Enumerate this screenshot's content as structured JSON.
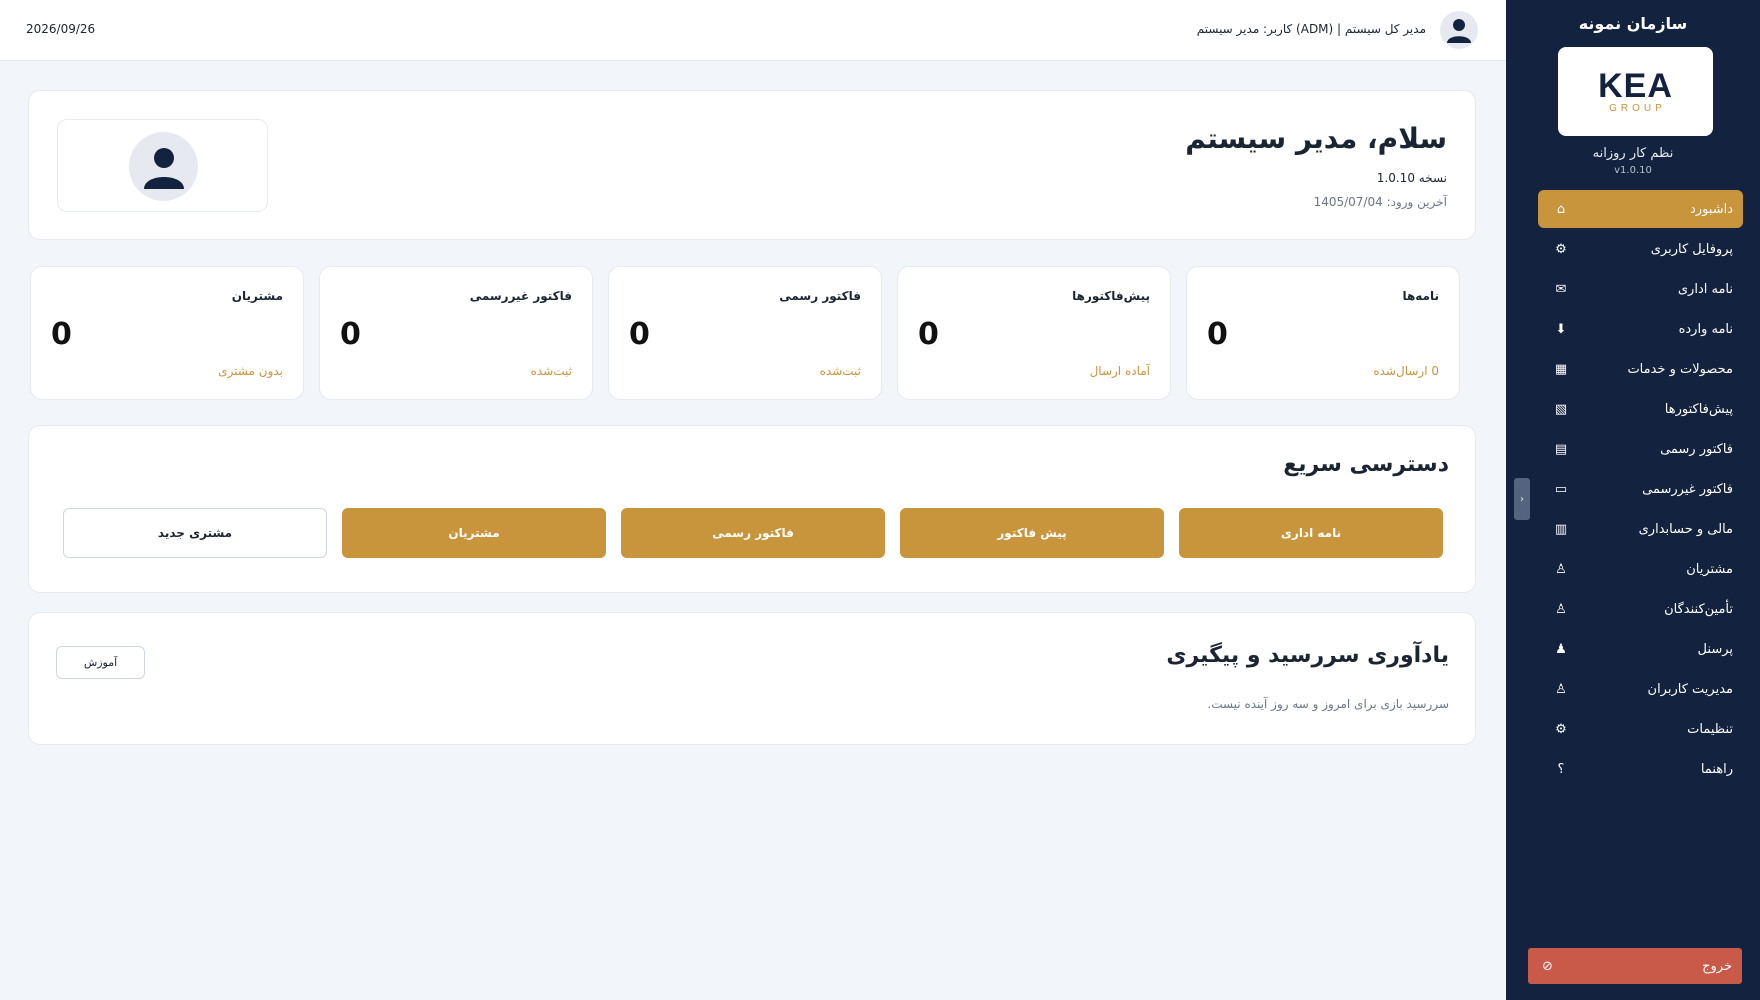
{
  "colors": {
    "sidebar_bg": "#13223f",
    "accent_gold": "#c8943c",
    "logout_red": "#c95a4a",
    "page_bg": "#f2f5f9"
  },
  "sidebar": {
    "org_name": "سازمان نمونه",
    "logo": {
      "main": "KEA",
      "sub": "GROUP"
    },
    "tagline": "نظم کار روزانه",
    "version": "v1.0.10",
    "items": [
      {
        "label": "داشبورد",
        "icon": "home-icon",
        "glyph": "⌂"
      },
      {
        "label": "پروفایل کاربری",
        "icon": "gear-icon",
        "glyph": "⚙"
      },
      {
        "label": "نامه اداری",
        "icon": "mail-icon",
        "glyph": "✉"
      },
      {
        "label": "نامه وارده",
        "icon": "download-icon",
        "glyph": "⬇"
      },
      {
        "label": "محصولات و خدمات",
        "icon": "grid-icon",
        "glyph": "▦"
      },
      {
        "label": "پیش‌فاکتورها",
        "icon": "hatched-doc-icon",
        "glyph": "▧"
      },
      {
        "label": "فاکتور رسمی",
        "icon": "lined-doc-icon",
        "glyph": "▤"
      },
      {
        "label": "فاکتور غیررسمی",
        "icon": "rectangle-icon",
        "glyph": "▭"
      },
      {
        "label": "مالی و حسابداری",
        "icon": "ledger-icon",
        "glyph": "▥"
      },
      {
        "label": "مشتریان",
        "icon": "person-icon",
        "glyph": "♙"
      },
      {
        "label": "تأمین‌کنندگان",
        "icon": "person-icon",
        "glyph": "♙"
      },
      {
        "label": "پرسنل",
        "icon": "person-icon",
        "glyph": "♟"
      },
      {
        "label": "مدیریت کاربران",
        "icon": "person-icon",
        "glyph": "♙"
      },
      {
        "label": "تنظیمات",
        "icon": "settings-icon",
        "glyph": "⚙"
      },
      {
        "label": "راهنما",
        "icon": "help-icon",
        "glyph": "؟"
      }
    ],
    "collapse_glyph": "‹",
    "logout": {
      "label": "خروج",
      "icon": "logout-icon",
      "glyph": "⦸"
    }
  },
  "topbar": {
    "date": "2026/09/26",
    "user": "کاربر: مدیر سیستم (ADM) | مدیر کل سیستم"
  },
  "welcome": {
    "title": "سلام، مدیر سیستم",
    "version": "نسخه 1.0.10",
    "last_login": "آخرین ورود: 1405/07/04"
  },
  "stats": [
    {
      "title": "نامه‌ها",
      "value": "0",
      "sub": "0 ارسال‌شده"
    },
    {
      "title": "پیش‌فاکتورها",
      "value": "0",
      "sub": "آماده ارسال"
    },
    {
      "title": "فاکتور رسمی",
      "value": "0",
      "sub": "ثبت‌شده"
    },
    {
      "title": "فاکتور غیررسمی",
      "value": "0",
      "sub": "ثبت‌شده"
    },
    {
      "title": "مشتریان",
      "value": "0",
      "sub": "بدون مشتری"
    }
  ],
  "quick_access": {
    "title": "دسترسی سریع",
    "buttons": [
      {
        "label": "نامه اداری"
      },
      {
        "label": "پیش فاکتور"
      },
      {
        "label": "فاکتور رسمی"
      },
      {
        "label": "مشتریان"
      },
      {
        "label": "مشتری جدید"
      }
    ]
  },
  "reminder": {
    "title": "یادآوری سررسید و پیگیری",
    "text": "سررسید بازی برای امروز و سه روز آینده نیست.",
    "tutorial_label": "آموزش"
  }
}
